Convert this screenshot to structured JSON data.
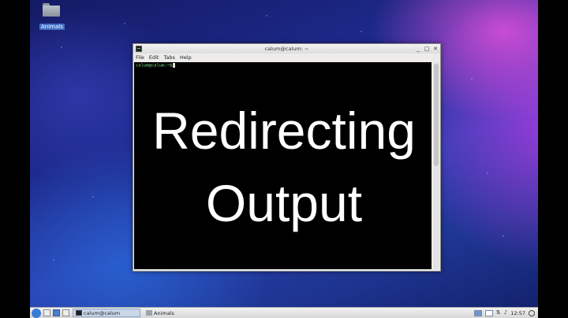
{
  "desktop": {
    "icons": [
      {
        "label": "Animals",
        "icon": "folder-icon"
      }
    ]
  },
  "window": {
    "title": "calum@calum: ~",
    "menu": [
      "File",
      "Edit",
      "Tabs",
      "Help"
    ],
    "controls": {
      "minimize": "_",
      "maximize": "□",
      "close": "✕"
    },
    "prompt": "calum@calum:~$"
  },
  "overlay": {
    "line1": "Redirecting",
    "line2": "Output"
  },
  "taskbar": {
    "tasks": [
      {
        "label": "calum@calum",
        "icon": "terminal-icon",
        "active": true
      },
      {
        "label": "Animals",
        "icon": "folder-icon",
        "active": false
      }
    ],
    "clock": "12:57",
    "volume_icon": "♪",
    "network_icon": "⇅"
  },
  "colors": {
    "desktop_gradient": [
      "#141a64",
      "#2a3fb0",
      "#be3ce6"
    ],
    "terminal_bg": "#000000",
    "prompt_green": "#7de07d"
  }
}
